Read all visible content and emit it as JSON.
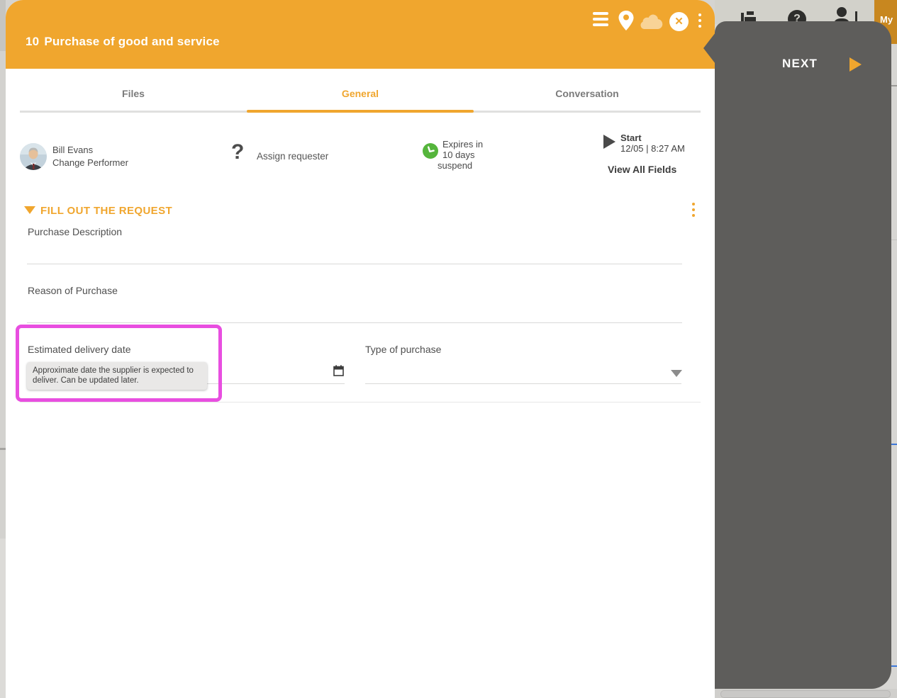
{
  "header": {
    "card_number": "10",
    "title": "Purchase of good and service"
  },
  "tabs": [
    {
      "label": "Files",
      "active": false
    },
    {
      "label": "General",
      "active": true
    },
    {
      "label": "Conversation",
      "active": false
    }
  ],
  "info": {
    "performer_name": "Bill Evans",
    "performer_role": "Change Performer",
    "assign_requester_label": "Assign requester",
    "expires_line1": "Expires in",
    "expires_line2": "10 days",
    "expires_line3": "suspend",
    "start_label": "Start",
    "start_datetime": "12/05 | 8:27 AM",
    "view_all_fields_label": "View All Fields"
  },
  "form": {
    "section_title": "FILL OUT THE REQUEST",
    "purchase_description_label": "Purchase Description",
    "reason_of_purchase_label": "Reason of Purchase",
    "estimated_delivery_date_label": "Estimated delivery date",
    "estimated_delivery_date_tooltip": "Approximate date the supplier is expected to deliver. Can be updated later.",
    "type_of_purchase_label": "Type of purchase"
  },
  "overlay": {
    "next_label": "NEXT"
  },
  "background": {
    "corner_text": "My"
  },
  "icons": {
    "header": [
      "menu-icon",
      "location-pin-icon",
      "cloud-icon",
      "close-icon",
      "vertical-ellipsis-icon"
    ],
    "info_row": [
      "question-mark-icon",
      "clock-icon",
      "play-icon"
    ],
    "section": [
      "triangle-down-icon",
      "vertical-ellipsis-icon"
    ],
    "fields": [
      "calendar-icon",
      "dropdown-caret-icon"
    ],
    "overlay": [
      "next-play-icon"
    ]
  },
  "colors": {
    "accent_orange": "#f0a62e",
    "corner_orange": "#c8871f",
    "highlight_magenta": "#e84ee0",
    "expire_green": "#55b53c",
    "panel_dark": "#5e5d5b",
    "field_line_gray": "#d9d9d8"
  }
}
